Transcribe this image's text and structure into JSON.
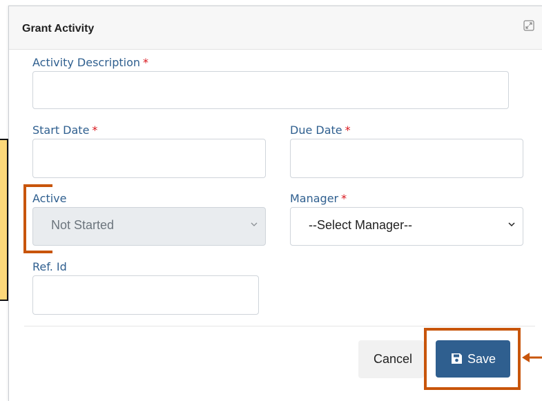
{
  "dialog": {
    "title": "Grant Activity"
  },
  "form": {
    "activity_description": {
      "label": "Activity Description",
      "required_mark": "*",
      "value": ""
    },
    "start_date": {
      "label": "Start Date",
      "required_mark": "*",
      "value": ""
    },
    "due_date": {
      "label": "Due Date",
      "required_mark": "*",
      "value": ""
    },
    "active": {
      "label": "Active",
      "selected": "Not Started"
    },
    "manager": {
      "label": "Manager",
      "required_mark": "*",
      "selected": "--Select Manager--"
    },
    "ref_id": {
      "label": "Ref. Id",
      "value": ""
    }
  },
  "footer": {
    "cancel_label": "Cancel",
    "save_label": "Save"
  },
  "annotations": {
    "accent_color": "#c8550b",
    "callout_color": "#fcd87a"
  },
  "colors": {
    "label": "#2f5f8f",
    "required": "#d9161c",
    "save_button": "#2f5f8f"
  }
}
